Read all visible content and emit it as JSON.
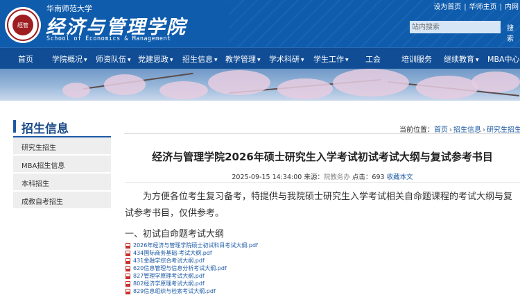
{
  "header": {
    "school_name": "华南师范大学",
    "college_name": "经济与管理学院",
    "college_name_en": "School of Economics & Management",
    "seal_text": "經管",
    "top_links": [
      "设为首页",
      "华师主页",
      "内网"
    ],
    "search_placeholder": "站内搜索",
    "search_button": "搜索"
  },
  "nav": {
    "items": [
      {
        "label": "首页",
        "dropdown": false
      },
      {
        "label": "学院概况",
        "dropdown": true
      },
      {
        "label": "师资队伍",
        "dropdown": true
      },
      {
        "label": "党建思政",
        "dropdown": true
      },
      {
        "label": "招生信息",
        "dropdown": true
      },
      {
        "label": "教学管理",
        "dropdown": true
      },
      {
        "label": "学术科研",
        "dropdown": true
      },
      {
        "label": "学生工作",
        "dropdown": true
      },
      {
        "label": "工会",
        "dropdown": false
      },
      {
        "label": "培训服务",
        "dropdown": false
      },
      {
        "label": "继续教育",
        "dropdown": true
      },
      {
        "label": "MBA中心",
        "dropdown": false
      }
    ]
  },
  "sidebar": {
    "title": "招生信息",
    "items": [
      {
        "label": "研究生招生"
      },
      {
        "label": "MBA招生信息"
      },
      {
        "label": "本科招生"
      },
      {
        "label": "成教自考招生"
      }
    ]
  },
  "breadcrumb": {
    "prefix": "当前位置：",
    "items": [
      "首页",
      "招生信息",
      "研究生招生"
    ]
  },
  "article": {
    "title": "经济与管理学院2026年硕士研究生入学考试初试考试大纲与复试参考书目",
    "datetime": "2025-09-15 14:34:00",
    "source_label": "来源：",
    "source": "院教务办",
    "clicks_label": "点击：",
    "clicks": "693",
    "favorite": "收藏本文",
    "intro": "为方便各位考生复习备考，特提供与我院硕士研究生入学考试相关自命题课程的考试大纲与复试参考书目，仅供参考。",
    "section_heading": "一、初试自命题考试大纲",
    "files": [
      {
        "name": "2026年经济与管理学院硕士初试科目考试大纲.pdf",
        "icon": "pdf-icon"
      },
      {
        "name": "434国际商务基础-考试大纲.pdf",
        "icon": "pdf-icon"
      },
      {
        "name": "431金融学综合考试大纲.pdf",
        "icon": "pdf-icon"
      },
      {
        "name": "620信息管理与信息分析考试大纲.pdf",
        "icon": "pdf-icon"
      },
      {
        "name": "827管理学原理考试大纲.pdf",
        "icon": "pdf-icon"
      },
      {
        "name": "802经济学原理考试大纲.pdf",
        "icon": "pdf-icon"
      },
      {
        "name": "829信息组织与检索考试大纲.pdf",
        "icon": "pdf-icon"
      }
    ]
  },
  "colors": {
    "header_blue": "#0f5cad",
    "nav_blue": "#114d95",
    "link_blue": "#1d5aa6",
    "seal_red": "#9d1d21"
  }
}
